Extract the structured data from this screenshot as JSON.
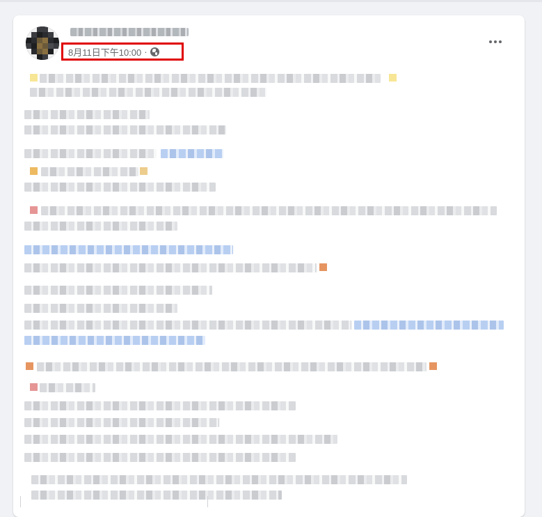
{
  "post": {
    "author_name": "",
    "timestamp": "8月11日下午10:00",
    "separator": "·",
    "audience_icon": "globe-icon",
    "menu_icon": "more-options-icon"
  },
  "colors": {
    "highlight_box": "#e00000",
    "meta_text": "#65676b",
    "page_bg": "#f0f2f5",
    "card_bg": "#ffffff"
  }
}
